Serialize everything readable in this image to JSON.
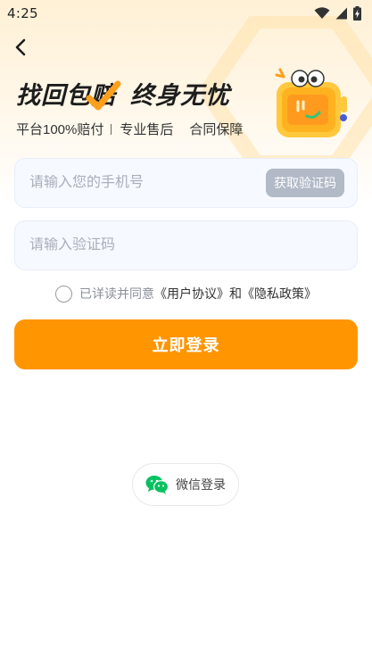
{
  "status_bar": {
    "time": "4:25",
    "icons": [
      "wifi-icon",
      "signal-icon",
      "battery-charging-icon"
    ]
  },
  "header": {
    "back_icon": "chevron-left-icon",
    "headline_part1": "找回包赔",
    "headline_part2": "终身无忧",
    "subline_item1": "平台100%赔付",
    "subline_item2": "专业售后",
    "subline_item3": "合同保障",
    "mascot": "robot-mascot-illustration"
  },
  "form": {
    "phone_placeholder": "请输入您的手机号",
    "phone_value": "",
    "get_code_label": "获取验证码",
    "code_placeholder": "请输入验证码",
    "code_value": ""
  },
  "agreement": {
    "checked": false,
    "prefix": "已详读并同意",
    "user_agreement": "《用户协议》",
    "conjunction": "和",
    "privacy_policy": "《隐私政策》"
  },
  "login_button_label": "立即登录",
  "wechat_login_label": "微信登录",
  "colors": {
    "accent": "#ff9500",
    "code_button": "#b2b9c7",
    "input_bg": "#f6f9ff",
    "wechat_green": "#07c160",
    "header_gradient_top": "#fff1d6"
  }
}
